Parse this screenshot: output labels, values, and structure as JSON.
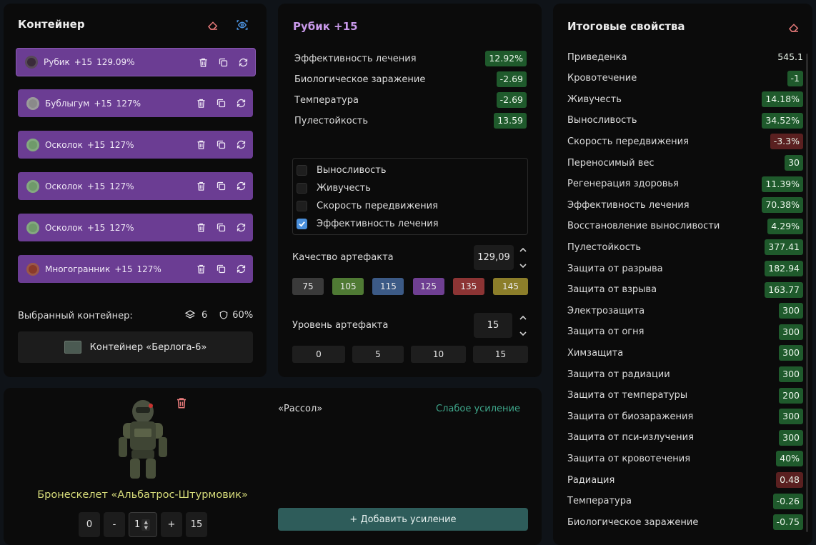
{
  "container": {
    "title": "Контейнер",
    "artifacts": [
      {
        "name": "Рубик",
        "level": "+15",
        "quality": "129.09%",
        "icon_color": "#3a2a3a"
      },
      {
        "name": "Бублыгум",
        "level": "+15",
        "quality": "127%",
        "icon_color": "#8a8a8a"
      },
      {
        "name": "Осколок",
        "level": "+15",
        "quality": "127%",
        "icon_color": "#6f9a6a"
      },
      {
        "name": "Осколок",
        "level": "+15",
        "quality": "127%",
        "icon_color": "#6f9a6a"
      },
      {
        "name": "Осколок",
        "level": "+15",
        "quality": "127%",
        "icon_color": "#6f9a6a"
      },
      {
        "name": "Многогранник",
        "level": "+15",
        "quality": "127%",
        "icon_color": "#8a3a2a"
      }
    ],
    "selected_label": "Выбранный контейнер:",
    "slots": "6",
    "protection": "60%",
    "container_name": "Контейнер «Берлога-6»"
  },
  "artifact": {
    "title": "Рубик +15",
    "props": [
      {
        "name": "Эффективность лечения",
        "value": "12.92%",
        "tone": "good"
      },
      {
        "name": "Биологическое заражение",
        "value": "-2.69",
        "tone": "good"
      },
      {
        "name": "Температура",
        "value": "-2.69",
        "tone": "good"
      },
      {
        "name": "Пулестойкость",
        "value": "13.59",
        "tone": "good"
      }
    ],
    "checks": [
      {
        "label": "Выносливость",
        "checked": false
      },
      {
        "label": "Живучесть",
        "checked": false
      },
      {
        "label": "Скорость передвижения",
        "checked": false
      },
      {
        "label": "Эффективность лечения",
        "checked": true
      }
    ],
    "quality_label": "Качество артефакта",
    "quality_value": "129,09",
    "quality_presets": [
      {
        "label": "75",
        "color": "#3a3a3a"
      },
      {
        "label": "105",
        "color": "#4f7a34"
      },
      {
        "label": "115",
        "color": "#3c5a86"
      },
      {
        "label": "125",
        "color": "#6f3f92"
      },
      {
        "label": "135",
        "color": "#8c3434"
      },
      {
        "label": "145",
        "color": "#8c7e2a"
      }
    ],
    "level_label": "Уровень артефакта",
    "level_value": "15",
    "level_presets": [
      "0",
      "5",
      "10",
      "15"
    ]
  },
  "summary": {
    "title": "Итоговые свойства",
    "rows": [
      {
        "name": "Приведенка",
        "value": "545.1",
        "tone": "plain"
      },
      {
        "name": "Кровотечение",
        "value": "-1",
        "tone": "good"
      },
      {
        "name": "Живучесть",
        "value": "14.18%",
        "tone": "good"
      },
      {
        "name": "Выносливость",
        "value": "34.52%",
        "tone": "good"
      },
      {
        "name": "Скорость передвижения",
        "value": "-3.3%",
        "tone": "bad"
      },
      {
        "name": "Переносимый вес",
        "value": "30",
        "tone": "good"
      },
      {
        "name": "Регенерация здоровья",
        "value": "11.39%",
        "tone": "good"
      },
      {
        "name": "Эффективность лечения",
        "value": "70.38%",
        "tone": "good"
      },
      {
        "name": "Восстановление выносливости",
        "value": "4.29%",
        "tone": "good"
      },
      {
        "name": "Пулестойкость",
        "value": "377.41",
        "tone": "good"
      },
      {
        "name": "Защита от разрыва",
        "value": "182.94",
        "tone": "good"
      },
      {
        "name": "Защита от взрыва",
        "value": "163.77",
        "tone": "good"
      },
      {
        "name": "Электрозащита",
        "value": "300",
        "tone": "good"
      },
      {
        "name": "Защита от огня",
        "value": "300",
        "tone": "good"
      },
      {
        "name": "Химзащита",
        "value": "300",
        "tone": "good"
      },
      {
        "name": "Защита от радиации",
        "value": "300",
        "tone": "good"
      },
      {
        "name": "Защита от температуры",
        "value": "200",
        "tone": "good"
      },
      {
        "name": "Защита от биозаражения",
        "value": "300",
        "tone": "good"
      },
      {
        "name": "Защита от пси-излучения",
        "value": "300",
        "tone": "good"
      },
      {
        "name": "Защита от кровотечения",
        "value": "40%",
        "tone": "good"
      },
      {
        "name": "Радиация",
        "value": "0.48",
        "tone": "bad"
      },
      {
        "name": "Температура",
        "value": "-0.26",
        "tone": "good"
      },
      {
        "name": "Биологическое заражение",
        "value": "-0.75",
        "tone": "good"
      }
    ]
  },
  "armor": {
    "name": "Бронескелет «Альбатрос-Штурмовик»",
    "min": "0",
    "minus": "-",
    "current": "1",
    "plus": "+",
    "max": "15",
    "booster_name": "«Рассол»",
    "booster_strength": "Слабое усиление",
    "add_label": "+ Добавить усиление"
  },
  "colors": {
    "artifact_row": "#6b3d93",
    "good": "#1f5a2c",
    "bad": "#5a2020",
    "accent_title": "#c999ea",
    "armor_name": "#d6db7a",
    "booster_strength": "#3ea68a"
  }
}
